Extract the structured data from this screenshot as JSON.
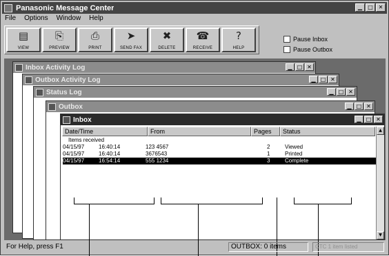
{
  "app": {
    "title": "Panasonic Message Center"
  },
  "menu": [
    {
      "label": "File"
    },
    {
      "label": "Options"
    },
    {
      "label": "Window"
    },
    {
      "label": "Help"
    }
  ],
  "toolbar": [
    {
      "label": "VIEW",
      "icon": "view-icon",
      "glyph": "▤"
    },
    {
      "label": "PREVIEW",
      "icon": "preview-icon",
      "glyph": "🗋"
    },
    {
      "label": "PRINT",
      "icon": "print-icon",
      "glyph": "⎙"
    },
    {
      "label": "SEND FAX",
      "icon": "send-fax-icon",
      "glyph": "✉"
    },
    {
      "label": "DELETE",
      "icon": "delete-icon",
      "glyph": "✖"
    },
    {
      "label": "RECEIVE",
      "icon": "receive-icon",
      "glyph": "☎"
    },
    {
      "label": "HELP",
      "icon": "help-icon",
      "glyph": "?"
    }
  ],
  "options": [
    {
      "label": "Pause Inbox",
      "checked": false
    },
    {
      "label": "Pause Outbox",
      "checked": false
    }
  ],
  "windows": {
    "inbox_log": "Inbox Activity Log",
    "outbox_log": "Outbox Activity Log",
    "status_log": "Status Log",
    "outbox": "Outbox",
    "inbox": "Inbox"
  },
  "inbox": {
    "columns": [
      "Date/Time",
      "From",
      "Pages",
      "Status"
    ],
    "group_label": "Items received",
    "rows": [
      {
        "date": "04/15/97",
        "time": "16:40:14",
        "from": "123 4567",
        "pages": "2",
        "status": "Viewed"
      },
      {
        "date": "04/15/97",
        "time": "16:40:14",
        "from": "3676543",
        "pages": "1",
        "status": "Printed"
      },
      {
        "date": "04/15/97",
        "time": "16:54:14",
        "from": "555 1234",
        "pages": "3",
        "status": "Complete"
      }
    ]
  },
  "status": {
    "help": "For Help, press F1",
    "outbox": "OUTBOX: 0 items",
    "right": "CTC 1 item listed"
  }
}
